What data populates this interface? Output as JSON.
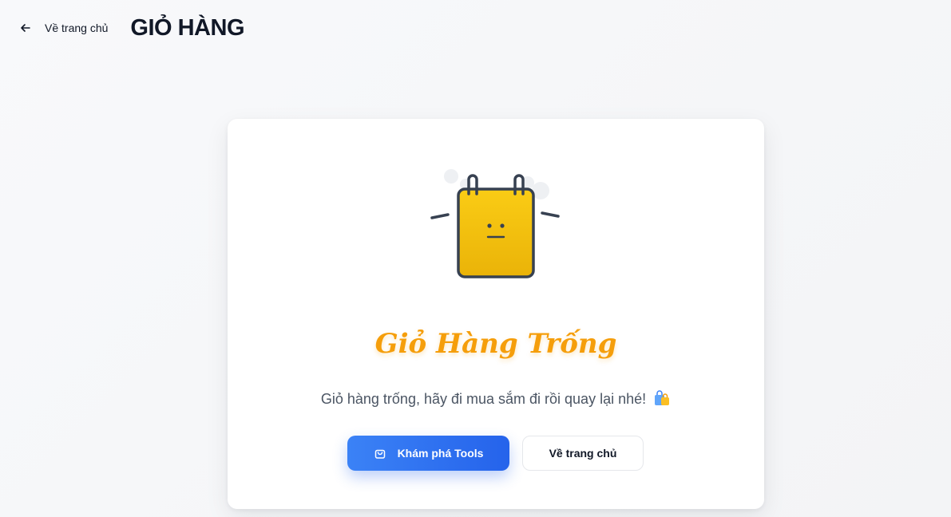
{
  "header": {
    "back_label": "Về trang chủ",
    "title": "GIỎ HÀNG"
  },
  "empty_state": {
    "title": "Giỏ Hàng Trống",
    "message": "Giỏ hàng trống, hãy đi mua sắm đi rồi quay lại nhé!",
    "mascot": "sad-notepad-illustration",
    "accent_color": "#f59e0b"
  },
  "actions": {
    "primary_label": "Khám phá Tools",
    "primary_icon": "shopping-bag-icon",
    "primary_color": "#2563eb",
    "secondary_label": "Về trang chủ"
  }
}
